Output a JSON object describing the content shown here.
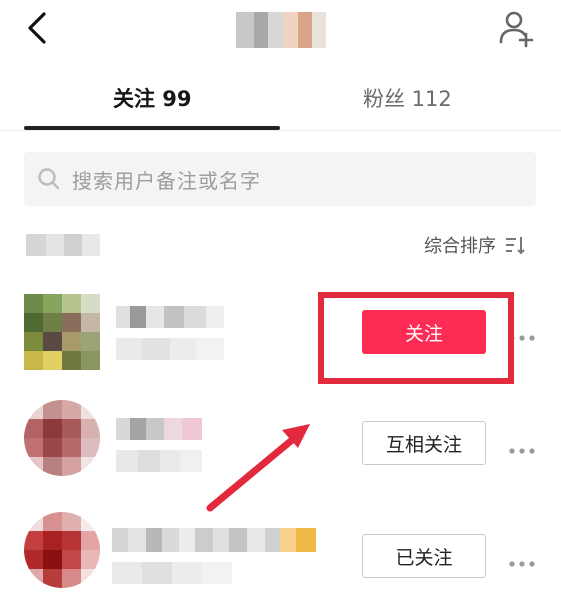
{
  "header": {
    "back_icon": "chevron-left-icon",
    "add_user_icon": "add-user-icon"
  },
  "tabs": [
    {
      "label": "关注 99",
      "active": true
    },
    {
      "label": "粉丝 112",
      "active": false
    }
  ],
  "search": {
    "placeholder": "搜索用户备注或名字",
    "icon": "search-icon"
  },
  "sort": {
    "label": "综合排序",
    "icon": "sort-icon"
  },
  "users": [
    {
      "action_label": "关注",
      "action_style": "primary"
    },
    {
      "action_label": "互相关注",
      "action_style": "outline"
    },
    {
      "action_label": "已关注",
      "action_style": "outline"
    }
  ],
  "colors": {
    "accent": "#fe2c55",
    "annotation": "#e32a3d",
    "text_primary": "#161616",
    "text_secondary": "#6b6b6b"
  }
}
